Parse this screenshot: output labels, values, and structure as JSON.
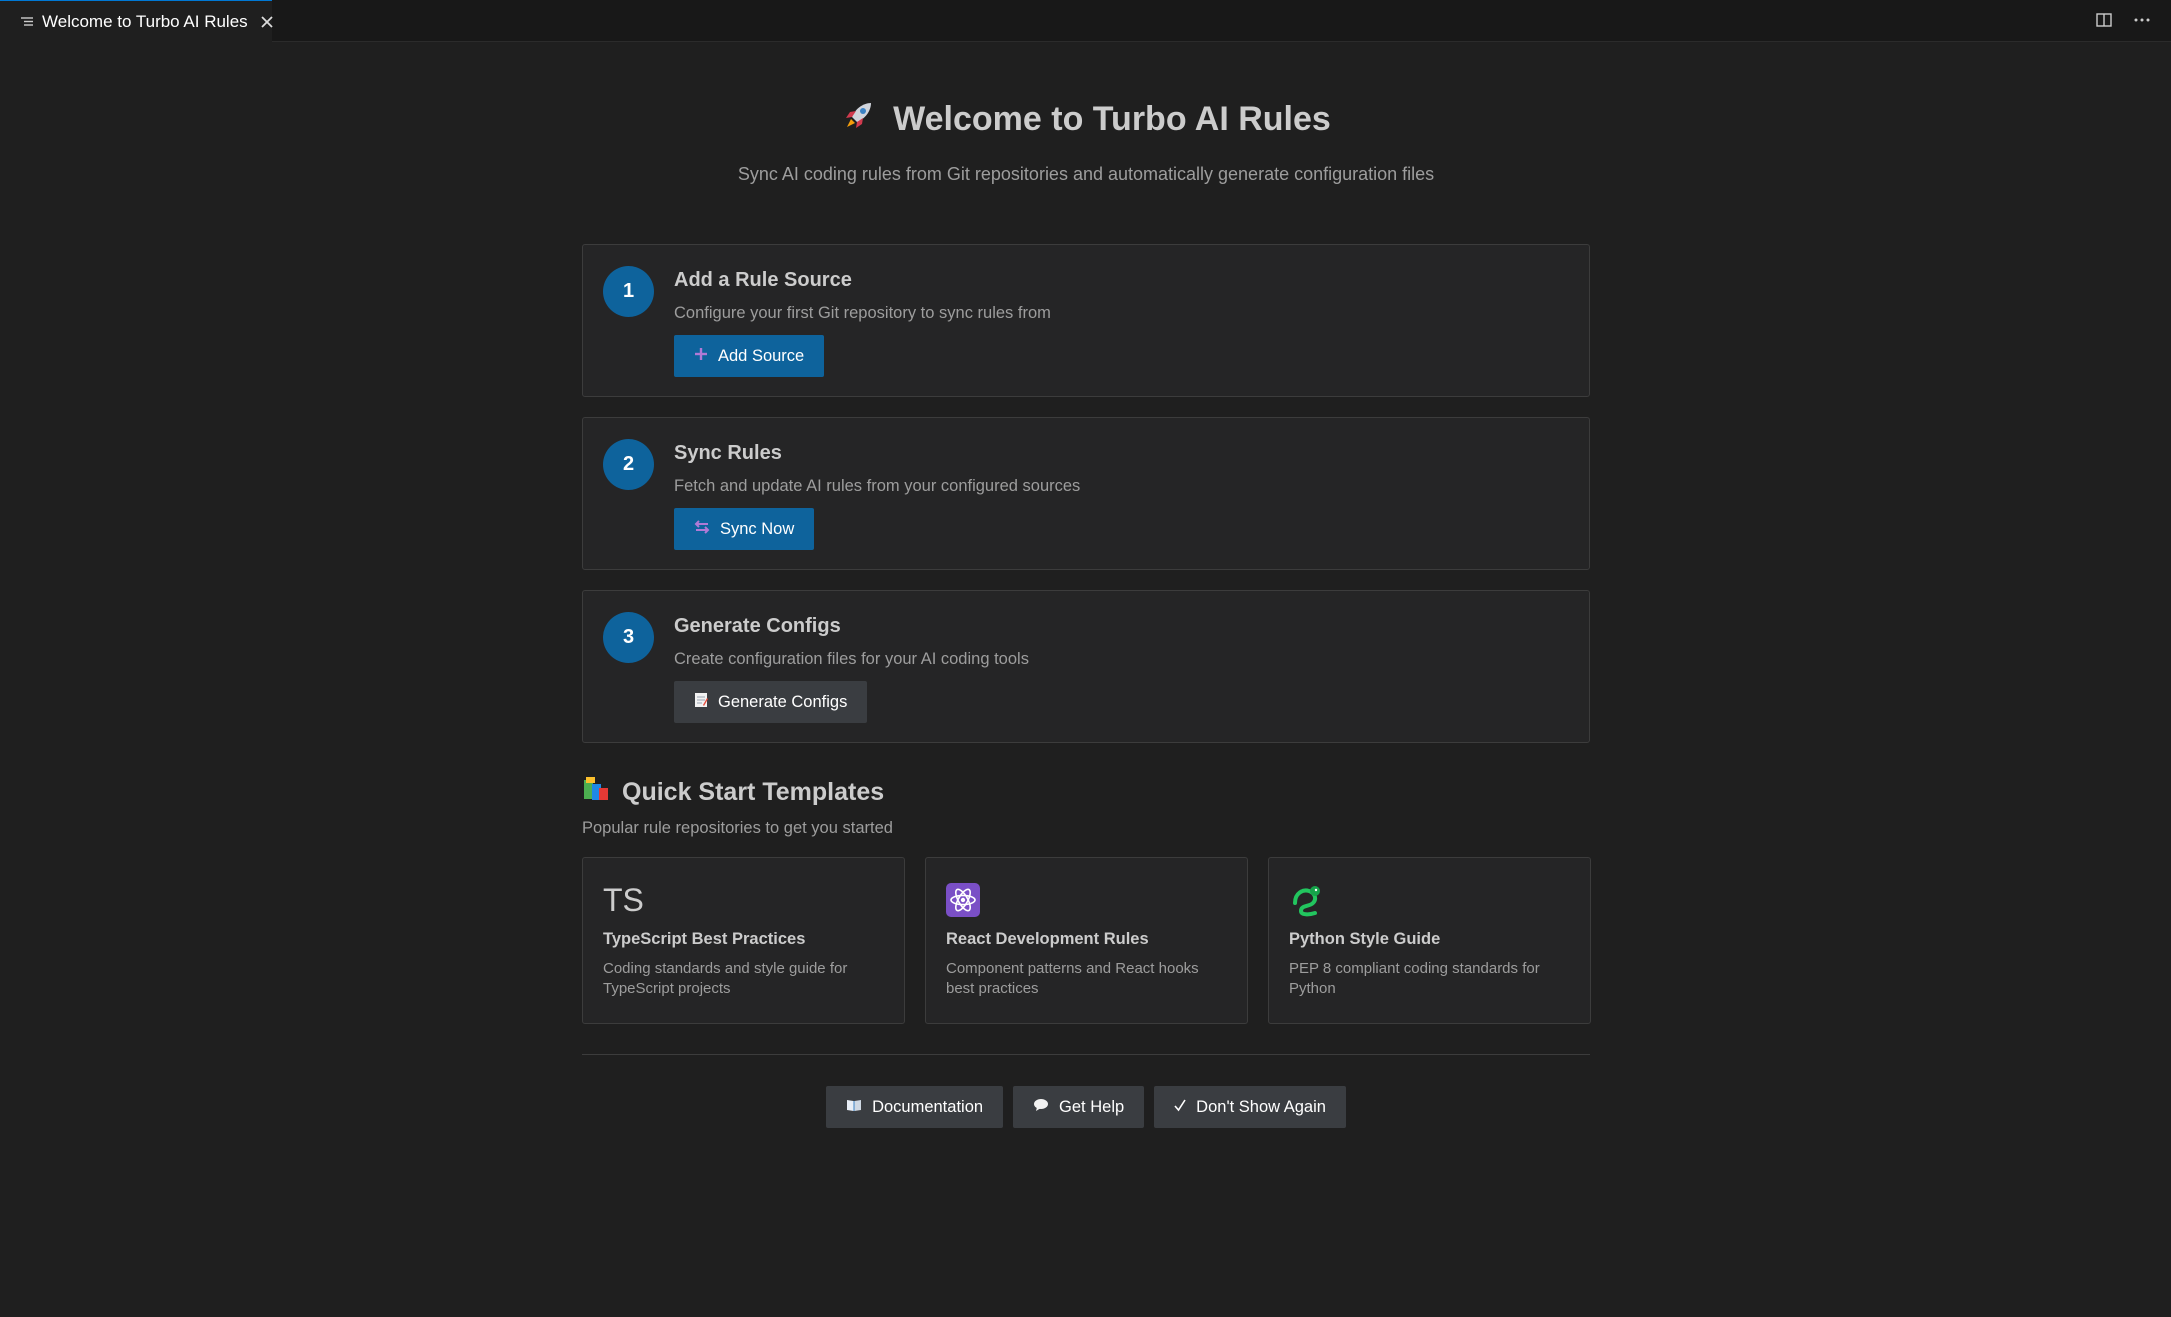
{
  "tab": {
    "label": "Welcome to Turbo AI Rules",
    "icon": "preview-icon",
    "close_icon": "close-icon"
  },
  "toolbar": {
    "actions": [
      "split-editor-icon",
      "more-actions-icon"
    ]
  },
  "hero": {
    "icon": "rocket-icon",
    "title": "Welcome to Turbo AI Rules",
    "subtitle": "Sync AI coding rules from Git repositories and automatically generate configuration files"
  },
  "steps": [
    {
      "number": "1",
      "title": "Add a Rule Source",
      "description": "Configure your first Git repository to sync rules from",
      "button_icon": "plus-icon",
      "button_label": "Add Source",
      "button_style": "primary"
    },
    {
      "number": "2",
      "title": "Sync Rules",
      "description": "Fetch and update AI rules from your configured sources",
      "button_icon": "sync-arrows-icon",
      "button_label": "Sync Now",
      "button_style": "primary"
    },
    {
      "number": "3",
      "title": "Generate Configs",
      "description": "Create configuration files for your AI coding tools",
      "button_icon": "memo-icon",
      "button_label": "Generate Configs",
      "button_style": "secondary"
    }
  ],
  "quick_start": {
    "icon": "books-icon",
    "title": "Quick Start Templates",
    "subtitle": "Popular rule repositories to get you started",
    "templates": [
      {
        "icon": "typescript-icon",
        "icon_text": "TS",
        "title": "TypeScript Best Practices",
        "description": "Coding standards and style guide for TypeScript projects"
      },
      {
        "icon": "react-atom-icon",
        "title": "React Development Rules",
        "description": "Component patterns and React hooks best practices"
      },
      {
        "icon": "python-snake-icon",
        "title": "Python Style Guide",
        "description": "PEP 8 compliant coding standards for Python"
      }
    ]
  },
  "footer": {
    "documentation_label": "Documentation",
    "get_help_label": "Get Help",
    "dont_show_label": "Don't Show Again"
  },
  "colors": {
    "background": "#1f1f1f",
    "card": "#252526",
    "primary_button": "#0e639c",
    "secondary_button": "#3a3d41",
    "step_circle": "#0e639c"
  }
}
